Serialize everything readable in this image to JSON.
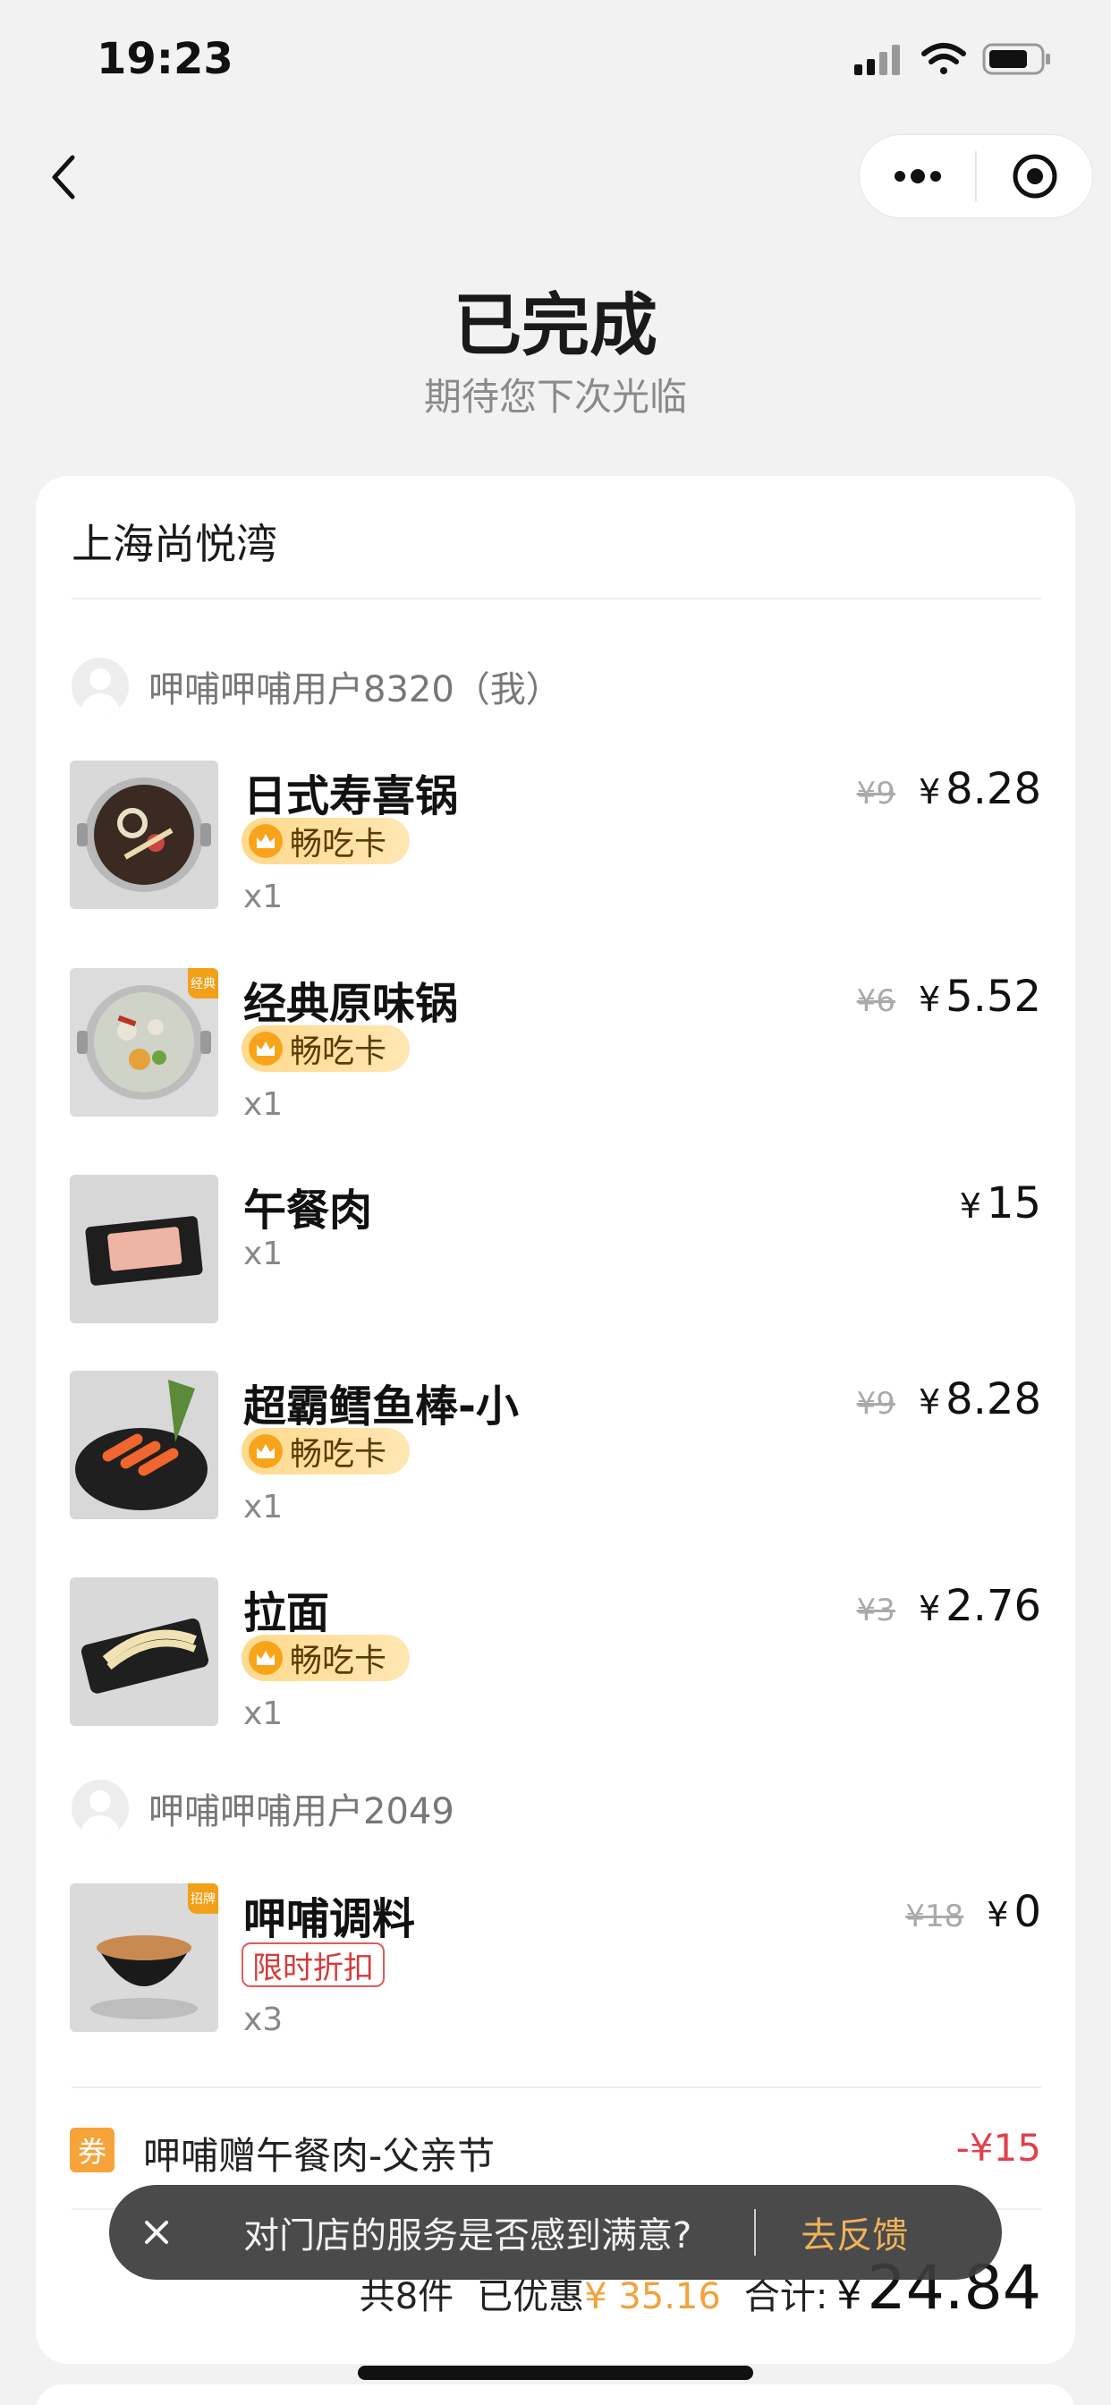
{
  "status_bar": {
    "time": "19:23"
  },
  "nav": {
    "back_icon": "chevron-left-icon",
    "more_icon": "more-dots-icon",
    "close_icon": "target-circle-icon"
  },
  "order_status": {
    "title": "已完成",
    "subtitle": "期待您下次光临"
  },
  "store": {
    "name": "上海尚悦湾"
  },
  "groups": [
    {
      "user": "呷哺呷哺用户8320（我）",
      "items": [
        {
          "name": "日式寿喜锅",
          "badge": "畅吃卡",
          "qty": "x1",
          "old_price": "¥9",
          "price": "8.28"
        },
        {
          "name": "经典原味锅",
          "badge": "畅吃卡",
          "qty": "x1",
          "old_price": "¥6",
          "price": "5.52",
          "corner_tag": "经典"
        },
        {
          "name": "午餐肉",
          "badge": "",
          "qty": "x1",
          "old_price": "",
          "price": "15"
        },
        {
          "name": "超霸鳕鱼棒-小",
          "badge": "畅吃卡",
          "qty": "x1",
          "old_price": "¥9",
          "price": "8.28"
        },
        {
          "name": "拉面",
          "badge": "畅吃卡",
          "qty": "x1",
          "old_price": "¥3",
          "price": "2.76"
        }
      ]
    },
    {
      "user": "呷哺呷哺用户2049",
      "items": [
        {
          "name": "呷哺调料",
          "badge": "限时折扣",
          "qty": "x3",
          "old_price": "¥18",
          "price": "0",
          "corner_tag": "招牌"
        }
      ]
    }
  ],
  "currency_symbol": "¥",
  "coupon": {
    "icon_text": "券",
    "label": "呷哺赠午餐肉-父亲节",
    "amount": "-¥15"
  },
  "summary": {
    "count": "共8件",
    "discount_label": "已优惠",
    "discount_value": "¥ 35.16",
    "total_label": "合计:",
    "total_value": "24.84"
  },
  "toast": {
    "message": "对门店的服务是否感到满意?",
    "action": "去反馈"
  },
  "colors": {
    "accent_orange": "#f3a13a",
    "discount_red": "#e0424a",
    "badge_gold": "#ffd98c"
  }
}
